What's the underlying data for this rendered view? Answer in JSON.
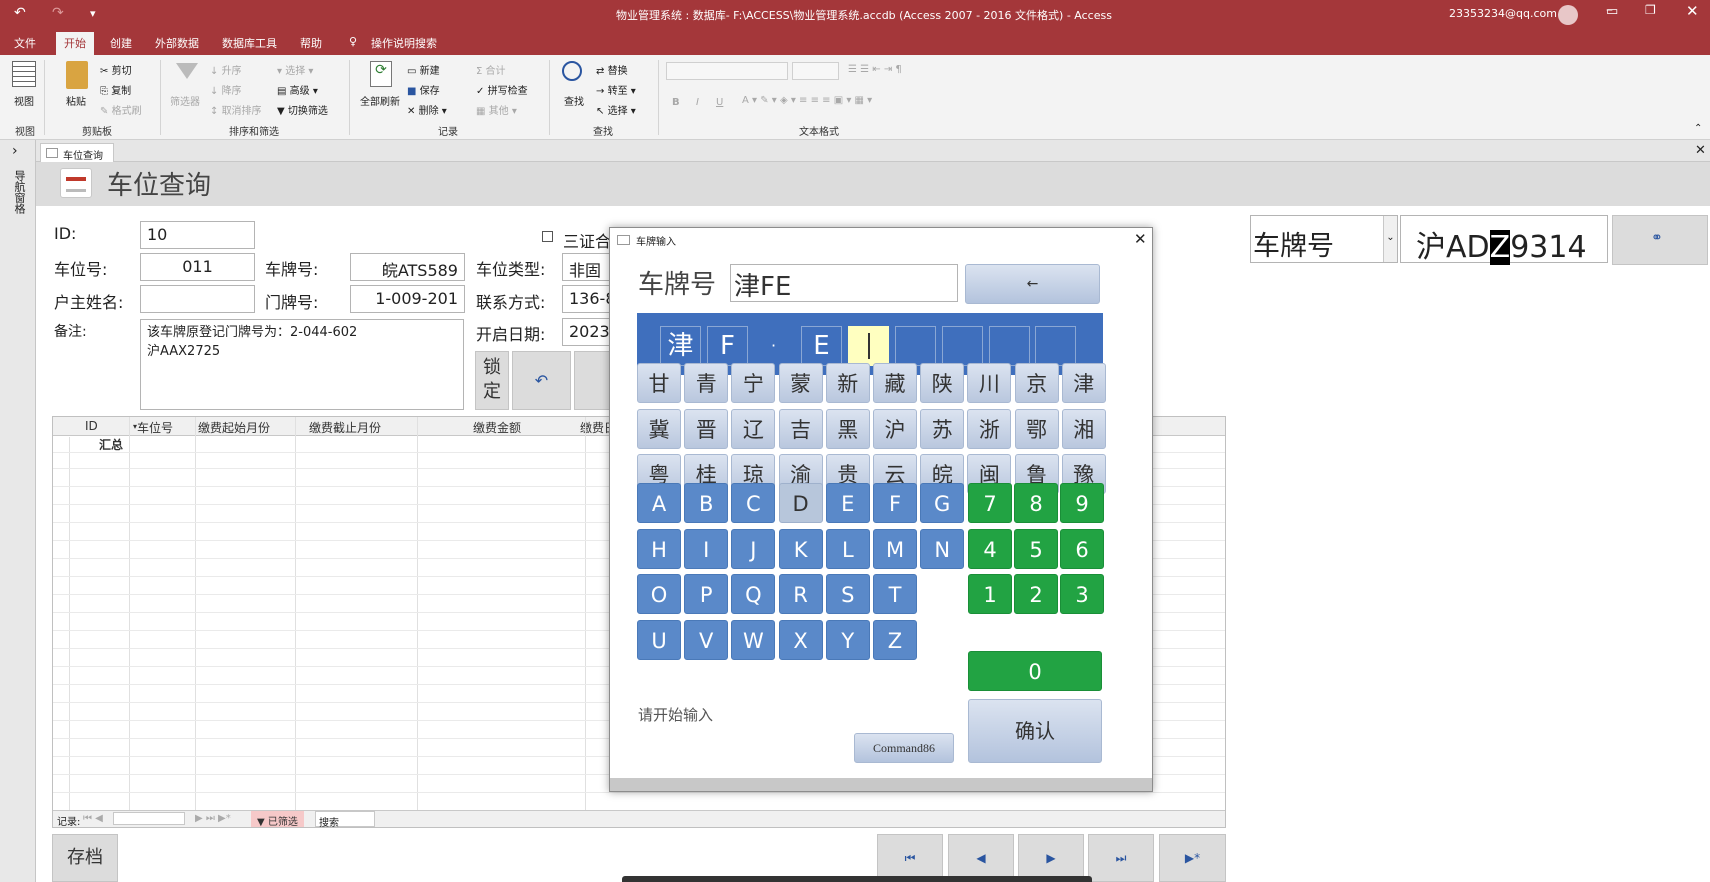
{
  "window": {
    "title": "物业管理系统 : 数据库- F:\\ACCESS\\物业管理系统.accdb (Access 2007 - 2016 文件格式)  -  Access",
    "user": "23353234@qq.com"
  },
  "menu": {
    "file": "文件",
    "home": "开始",
    "create": "创建",
    "external": "外部数据",
    "dbtools": "数据库工具",
    "help": "帮助",
    "tellme": "操作说明搜索"
  },
  "ribbon": {
    "view": "视图",
    "view_group": "视图",
    "paste": "粘贴",
    "cut": "剪切",
    "copy": "复制",
    "format_painter": "格式刷",
    "clipboard_group": "剪贴板",
    "filter": "筛选器",
    "ascending": "升序",
    "descending": "降序",
    "remove_sort": "取消排序",
    "selection": "选择",
    "advanced": "高级",
    "toggle_filter": "切换筛选",
    "sort_group": "排序和筛选",
    "refresh_all": "全部刷新",
    "new": "新建",
    "save": "保存",
    "delete": "删除",
    "totals": "合计",
    "spelling": "拼写检查",
    "more": "其他",
    "records_group": "记录",
    "find": "查找",
    "replace": "替换",
    "goto": "转至",
    "select": "选择",
    "find_group": "查找",
    "bold": "B",
    "italic": "I",
    "underline": "U",
    "text_format_group": "文本格式"
  },
  "nav_pane": {
    "label": "导航窗格"
  },
  "doc_tab": {
    "label": "车位查询"
  },
  "form": {
    "title": "车位查询",
    "id_label": "ID:",
    "id_value": "10",
    "space_no_label": "车位号:",
    "space_no_value": "011",
    "plate_label": "车牌号:",
    "plate_value": "皖ATS589",
    "space_type_label": "车位类型:",
    "space_type_value": "非固",
    "owner_label": "户主姓名:",
    "owner_value": "",
    "door_label": "门牌号:",
    "door_value": "1-009-201",
    "contact_label": "联系方式:",
    "contact_value": "136-8",
    "note_label": "备注:",
    "note_line1": "该车牌原登记门牌号为：2-044-602",
    "note_line2": "沪AAX2725",
    "open_date_label": "开启日期:",
    "open_date_value": "2023/",
    "three_certs_label": "三证合",
    "lock_button": "锁定",
    "archive_button": "存档"
  },
  "datasheet": {
    "columns": [
      "ID",
      "车位号",
      "缴费起始月份",
      "缴费截止月份",
      "缴费金额",
      "缴费日"
    ],
    "totals_label": "汇总",
    "nav_record": "记录:",
    "filtered": "已筛选",
    "search": "搜索"
  },
  "search_panel": {
    "field_selected": "车牌号",
    "plate_value_before": "沪AD",
    "plate_value_selected": "Z",
    "plate_value_after": "9314"
  },
  "dialog": {
    "title": "车牌输入",
    "plate_label": "车牌号",
    "plate_value": "津FE",
    "backspace": "←",
    "cells": [
      "津",
      "F",
      "·",
      "E",
      "",
      "",
      "",
      "",
      ""
    ],
    "province_rows": [
      [
        "甘",
        "青",
        "宁",
        "蒙",
        "新",
        "藏",
        "陕",
        "川",
        "京",
        "津"
      ],
      [
        "冀",
        "晋",
        "辽",
        "吉",
        "黑",
        "沪",
        "苏",
        "浙",
        "鄂",
        "湘"
      ],
      [
        "粤",
        "桂",
        "琼",
        "渝",
        "贵",
        "云",
        "皖",
        "闽",
        "鲁",
        "豫"
      ]
    ],
    "letter_rows": [
      [
        "A",
        "B",
        "C",
        "D",
        "E",
        "F",
        "G"
      ],
      [
        "H",
        "I",
        "J",
        "K",
        "L",
        "M",
        "N"
      ],
      [
        "O",
        "P",
        "Q",
        "R",
        "S",
        "T"
      ],
      [
        "U",
        "V",
        "W",
        "X",
        "Y",
        "Z"
      ]
    ],
    "selected_letter": "D",
    "digit_rows": [
      [
        "7",
        "8",
        "9"
      ],
      [
        "4",
        "5",
        "6"
      ],
      [
        "1",
        "2",
        "3"
      ]
    ],
    "zero": "0",
    "status": "请开始输入",
    "command_button": "Command86",
    "confirm": "确认"
  },
  "colors": {
    "titlebar": "#a4373a",
    "plate_strip": "#3f6fbd",
    "letter_key": "#5a89c9",
    "digit_key": "#22a343",
    "cursor_cell": "#ffffc0"
  }
}
